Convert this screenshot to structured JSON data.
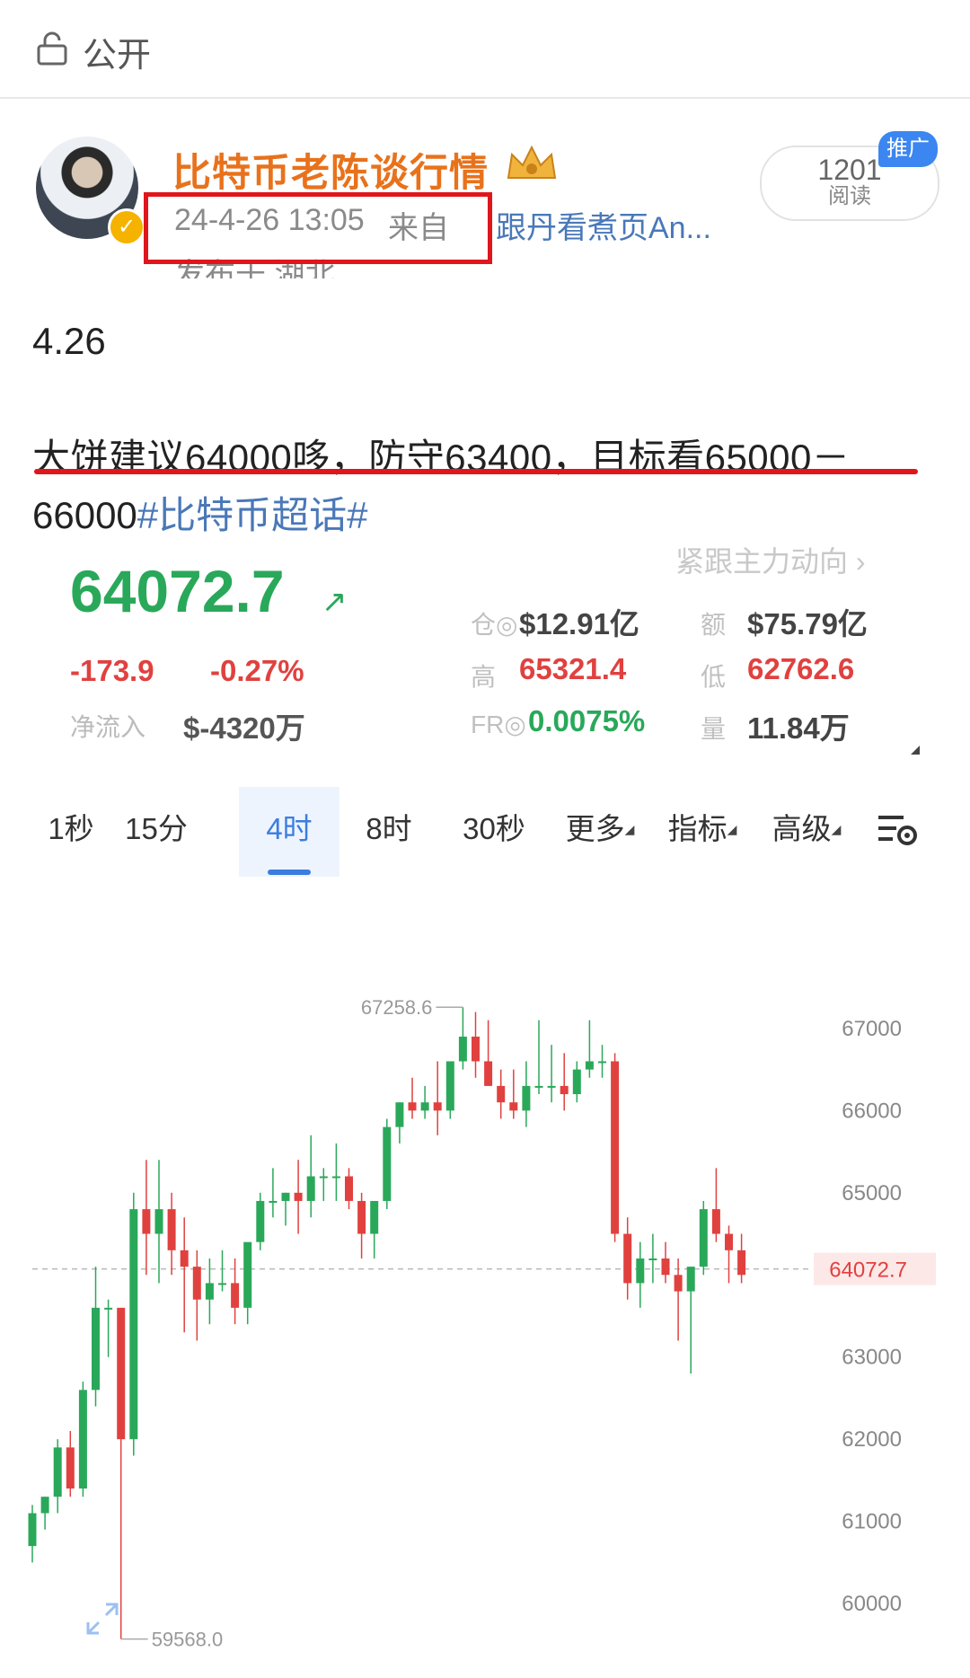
{
  "visibility": {
    "label": "公开",
    "icon": "lock-icon"
  },
  "post_header": {
    "user_name": "比特币老陈谈行情",
    "time": "24-4-26 13:05",
    "source_prefix": "来自",
    "client": "跟丹看煮页An...",
    "location": "发布于 湖北",
    "read_count": "1201",
    "read_label": "阅读",
    "promo_badge": "推广"
  },
  "post_body": {
    "date": "4.26",
    "line1": "大饼建议64000哆，防守63400，目标看65000－",
    "line2": "66000",
    "hashtag": "#比特币超话#"
  },
  "market": {
    "follow_link": "紧跟主力动向 ›",
    "price": "64072.7",
    "price_arrow": "↗",
    "change_abs": "-173.9",
    "change_pct": "-0.27%",
    "netflow_label": "净流入",
    "netflow_value": "$-4320万",
    "stats": {
      "oi_label": "仓◎",
      "oi_value": "$12.91亿",
      "amount_label": "额",
      "amount_value": "$75.79亿",
      "high_label": "高",
      "high_value": "65321.4",
      "low_label": "低",
      "low_value": "62762.6",
      "fr_label": "FR◎",
      "fr_value": "0.0075%",
      "volume_label": "量",
      "volume_value": "11.84万"
    }
  },
  "tabs": [
    {
      "label": "1秒",
      "active": false
    },
    {
      "label": "15分",
      "active": false
    },
    {
      "label": "4时",
      "active": true
    },
    {
      "label": "8时",
      "active": false
    },
    {
      "label": "30秒",
      "active": false
    },
    {
      "label": "更多",
      "active": false,
      "dropdown": true
    },
    {
      "label": "指标",
      "active": false,
      "dropdown": true
    },
    {
      "label": "高级",
      "active": false,
      "dropdown": true
    }
  ],
  "colors": {
    "up": "#2aa85a",
    "down": "#e0413f",
    "accent": "#3b7de0",
    "name": "#e8721c",
    "highlight": "#e0161d"
  },
  "chart_data": {
    "type": "candlestick",
    "ylim": [
      59400,
      67600
    ],
    "y_ticks": [
      60000,
      61000,
      62000,
      63000,
      65000,
      66000,
      67000
    ],
    "current_price": "64072.7",
    "max_label": "67258.6",
    "min_label": "59568.0",
    "candles": [
      {
        "o": 60700,
        "h": 61200,
        "l": 60500,
        "c": 61100
      },
      {
        "o": 61100,
        "h": 61300,
        "l": 60900,
        "c": 61300
      },
      {
        "o": 61300,
        "h": 62000,
        "l": 61100,
        "c": 61900
      },
      {
        "o": 61900,
        "h": 62100,
        "l": 61300,
        "c": 61400
      },
      {
        "o": 61400,
        "h": 62700,
        "l": 61300,
        "c": 62600
      },
      {
        "o": 62600,
        "h": 64100,
        "l": 62400,
        "c": 63600
      },
      {
        "o": 63600,
        "h": 63700,
        "l": 63000,
        "c": 63600
      },
      {
        "o": 63600,
        "h": 63600,
        "l": 59568,
        "c": 62000
      },
      {
        "o": 62000,
        "h": 65000,
        "l": 61800,
        "c": 64800
      },
      {
        "o": 64800,
        "h": 65400,
        "l": 64000,
        "c": 64500
      },
      {
        "o": 64500,
        "h": 65400,
        "l": 63900,
        "c": 64800
      },
      {
        "o": 64800,
        "h": 65000,
        "l": 64000,
        "c": 64300
      },
      {
        "o": 64300,
        "h": 64700,
        "l": 63300,
        "c": 64100
      },
      {
        "o": 64100,
        "h": 64300,
        "l": 63200,
        "c": 63700
      },
      {
        "o": 63700,
        "h": 64200,
        "l": 63400,
        "c": 63900
      },
      {
        "o": 63900,
        "h": 64300,
        "l": 63800,
        "c": 63900
      },
      {
        "o": 63900,
        "h": 64200,
        "l": 63400,
        "c": 63600
      },
      {
        "o": 63600,
        "h": 64100,
        "l": 63400,
        "c": 64400
      },
      {
        "o": 64400,
        "h": 65000,
        "l": 64300,
        "c": 64900
      },
      {
        "o": 64900,
        "h": 65300,
        "l": 64700,
        "c": 64900
      },
      {
        "o": 64900,
        "h": 65000,
        "l": 64600,
        "c": 65000
      },
      {
        "o": 65000,
        "h": 65400,
        "l": 64500,
        "c": 64900
      },
      {
        "o": 64900,
        "h": 65700,
        "l": 64700,
        "c": 65200
      },
      {
        "o": 65200,
        "h": 65300,
        "l": 64900,
        "c": 65200
      },
      {
        "o": 65200,
        "h": 65600,
        "l": 64900,
        "c": 65200
      },
      {
        "o": 65200,
        "h": 65300,
        "l": 64800,
        "c": 64900
      },
      {
        "o": 64900,
        "h": 65000,
        "l": 64200,
        "c": 64500
      },
      {
        "o": 64500,
        "h": 64900,
        "l": 64200,
        "c": 64900
      },
      {
        "o": 64900,
        "h": 65900,
        "l": 64800,
        "c": 65800
      },
      {
        "o": 65800,
        "h": 66100,
        "l": 65600,
        "c": 66100
      },
      {
        "o": 66100,
        "h": 66400,
        "l": 65900,
        "c": 66000
      },
      {
        "o": 66000,
        "h": 66300,
        "l": 65900,
        "c": 66100
      },
      {
        "o": 66100,
        "h": 66600,
        "l": 65700,
        "c": 66000
      },
      {
        "o": 66000,
        "h": 66600,
        "l": 65900,
        "c": 66600
      },
      {
        "o": 66600,
        "h": 67258.6,
        "l": 66500,
        "c": 66900
      },
      {
        "o": 66900,
        "h": 67200,
        "l": 66400,
        "c": 66600
      },
      {
        "o": 66600,
        "h": 67100,
        "l": 66300,
        "c": 66300
      },
      {
        "o": 66300,
        "h": 66500,
        "l": 65900,
        "c": 66100
      },
      {
        "o": 66100,
        "h": 66500,
        "l": 65900,
        "c": 66000
      },
      {
        "o": 66000,
        "h": 66600,
        "l": 65800,
        "c": 66300
      },
      {
        "o": 66300,
        "h": 67100,
        "l": 66200,
        "c": 66300
      },
      {
        "o": 66300,
        "h": 66800,
        "l": 66100,
        "c": 66300
      },
      {
        "o": 66300,
        "h": 66700,
        "l": 66000,
        "c": 66200
      },
      {
        "o": 66200,
        "h": 66600,
        "l": 66100,
        "c": 66500
      },
      {
        "o": 66500,
        "h": 67100,
        "l": 66400,
        "c": 66600
      },
      {
        "o": 66600,
        "h": 66800,
        "l": 66400,
        "c": 66600
      },
      {
        "o": 66600,
        "h": 66700,
        "l": 64400,
        "c": 64500
      },
      {
        "o": 64500,
        "h": 64700,
        "l": 63700,
        "c": 63900
      },
      {
        "o": 63900,
        "h": 64400,
        "l": 63600,
        "c": 64200
      },
      {
        "o": 64200,
        "h": 64500,
        "l": 63900,
        "c": 64200
      },
      {
        "o": 64200,
        "h": 64400,
        "l": 63900,
        "c": 64000
      },
      {
        "o": 64000,
        "h": 64200,
        "l": 63200,
        "c": 63800
      },
      {
        "o": 63800,
        "h": 64100,
        "l": 62800,
        "c": 64100
      },
      {
        "o": 64100,
        "h": 64900,
        "l": 64000,
        "c": 64800
      },
      {
        "o": 64800,
        "h": 65300,
        "l": 64400,
        "c": 64500
      },
      {
        "o": 64500,
        "h": 64600,
        "l": 63900,
        "c": 64300
      },
      {
        "o": 64300,
        "h": 64500,
        "l": 63900,
        "c": 64000
      }
    ]
  }
}
